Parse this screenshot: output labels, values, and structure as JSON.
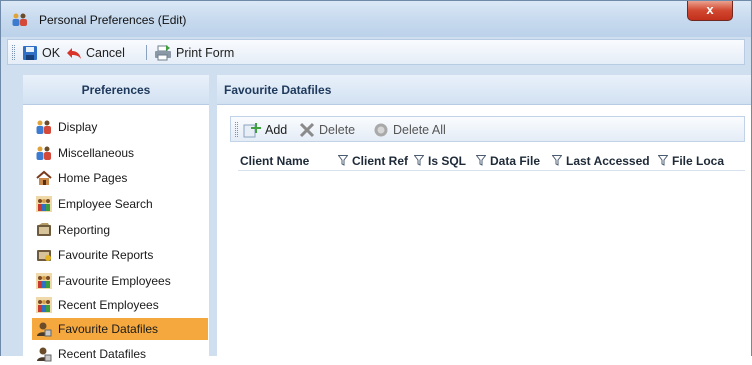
{
  "window": {
    "title": "Personal Preferences (Edit)",
    "close_label": "x"
  },
  "toolbar": {
    "ok_label": "OK",
    "cancel_label": "Cancel",
    "print_label": "Print Form"
  },
  "preferences": {
    "header": "Preferences",
    "items": [
      {
        "label": "Display",
        "icon": "people-icon"
      },
      {
        "label": "Miscellaneous",
        "icon": "people-icon"
      },
      {
        "label": "Home Pages",
        "icon": "home-icon"
      },
      {
        "label": "Employee Search",
        "icon": "employees-icon"
      },
      {
        "label": "Reporting",
        "icon": "report-icon"
      },
      {
        "label": "Favourite Reports",
        "icon": "report-icon"
      },
      {
        "label": "Favourite Employees",
        "icon": "employees-icon"
      },
      {
        "label": "Recent Employees",
        "icon": "employees-icon"
      },
      {
        "label": "Favourite Datafiles",
        "icon": "datafile-user-icon",
        "selected": true
      },
      {
        "label": "Recent Datafiles",
        "icon": "datafile-user-icon"
      }
    ]
  },
  "favourite_datafiles": {
    "header": "Favourite Datafiles",
    "add_label": "Add",
    "delete_label": "Delete",
    "delete_all_label": "Delete All",
    "columns": [
      "Client Name",
      "Client Ref",
      "Is SQL",
      "Data File",
      "Last Accessed",
      "File Loca"
    ]
  },
  "colors": {
    "selected": "#f5a83d",
    "header_text": "#1e395b",
    "close_button": "#c2301c"
  }
}
